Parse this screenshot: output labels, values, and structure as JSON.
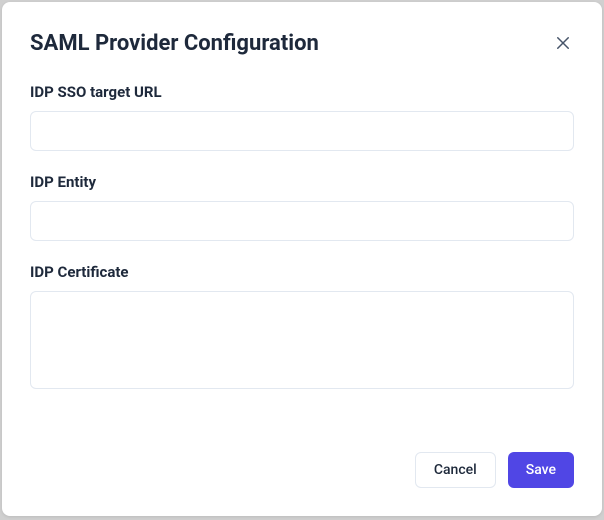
{
  "modal": {
    "title": "SAML Provider Configuration",
    "fields": {
      "sso_url": {
        "label": "IDP SSO target URL",
        "value": ""
      },
      "entity": {
        "label": "IDP Entity",
        "value": ""
      },
      "certificate": {
        "label": "IDP Certificate",
        "value": ""
      }
    },
    "buttons": {
      "cancel": "Cancel",
      "save": "Save"
    }
  }
}
